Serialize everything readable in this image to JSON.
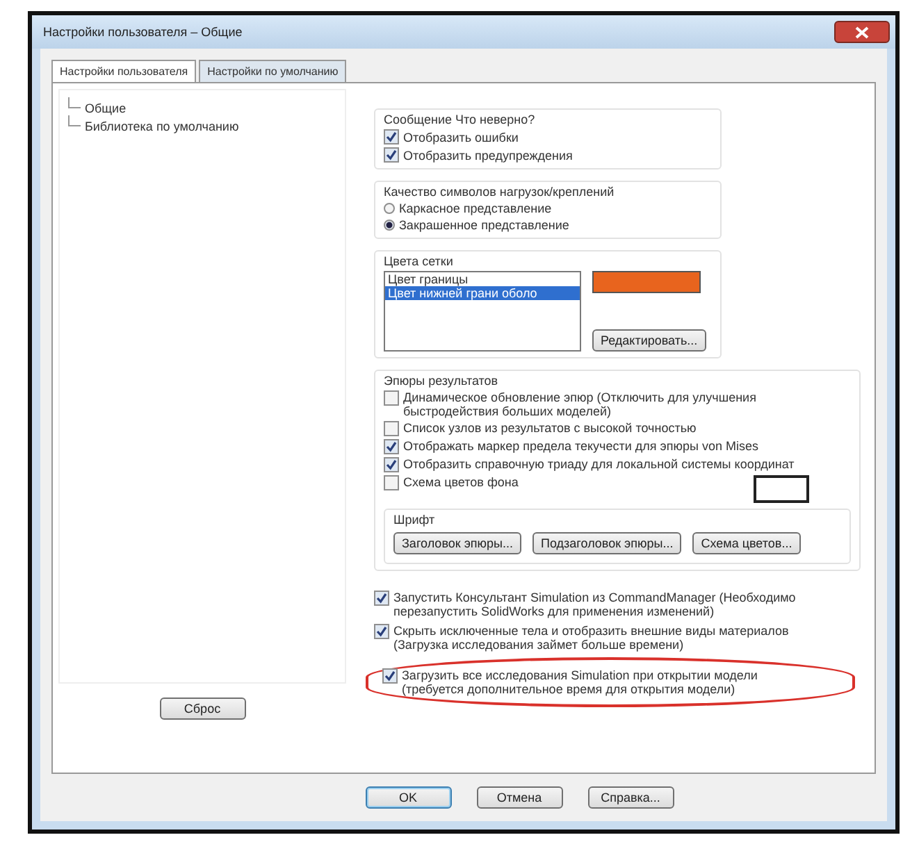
{
  "window": {
    "title": "Настройки пользователя – Общие"
  },
  "tabs": [
    {
      "label": "Настройки пользователя",
      "selected": true
    },
    {
      "label": "Настройки по умолчанию",
      "selected": false
    }
  ],
  "tree": [
    {
      "label": "Общие"
    },
    {
      "label": "Библиотека по умолчанию"
    }
  ],
  "reset_button": "Сброс",
  "messages": {
    "title": "Сообщение Что неверно?",
    "options": [
      {
        "label": "Отобразить ошибки",
        "checked": true
      },
      {
        "label": "Отобразить предупреждения",
        "checked": true
      }
    ]
  },
  "symbol_quality": {
    "title": "Качество символов нагрузок/креплений",
    "options": [
      {
        "label": "Каркасное представление",
        "selected": false
      },
      {
        "label": "Закрашенное представление",
        "selected": true
      }
    ]
  },
  "mesh_colors": {
    "title": "Цвета сетки",
    "items": [
      {
        "label": "Цвет границы",
        "selected": false
      },
      {
        "label": "Цвет нижней грани оболо",
        "selected": true,
        "color": "#e8641e"
      }
    ],
    "edit_button": "Редактировать..."
  },
  "plots": {
    "title": "Эпюры результатов",
    "options": [
      {
        "label": "Динамическое обновление эпюр (Отключить для улучшения быстродействия больших моделей)",
        "checked": false,
        "kind": "checkbox"
      },
      {
        "label": "Список узлов из результатов с высокой точностью",
        "checked": false,
        "kind": "checkbox"
      },
      {
        "label": "Отображать маркер предела текучести для эпюры von Mises",
        "checked": true,
        "kind": "checkbox"
      },
      {
        "label": "Отобразить справочную триаду для локальной системы координат",
        "checked": true,
        "kind": "checkbox"
      },
      {
        "label": "Схема цветов фона",
        "checked": false,
        "kind": "swatch"
      }
    ],
    "font": {
      "title": "Шрифт",
      "buttons": [
        "Заголовок эпюры...",
        "Подзаголовок эпюры...",
        "Схема цветов..."
      ]
    }
  },
  "options": [
    {
      "label": "Запустить Консультант Simulation из CommandManager (Необходимо перезапустить SolidWorks для применения изменений)",
      "checked": true,
      "highlighted": false
    },
    {
      "label": "Скрыть исключенные тела и отобразить внешние виды материалов (Загрузка исследования займет больше времени)",
      "checked": true,
      "highlighted": false
    },
    {
      "label": "Загрузить все исследования Simulation при открытии модели (требуется дополнительное время для открытия модели)",
      "checked": true,
      "highlighted": true
    }
  ],
  "buttons": [
    {
      "label": "OK",
      "default": true
    },
    {
      "label": "Отмена",
      "default": false
    },
    {
      "label": "Справка...",
      "default": false
    }
  ]
}
